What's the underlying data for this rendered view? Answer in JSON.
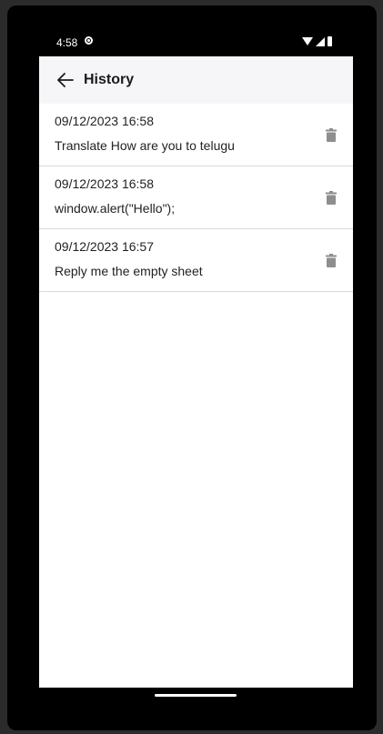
{
  "status_bar": {
    "time": "4:58"
  },
  "header": {
    "title": "History",
    "back_icon": "arrow-left-icon"
  },
  "history": [
    {
      "date": "09/12/2023 16:58",
      "text": "Translate How are you to telugu"
    },
    {
      "date": "09/12/2023 16:58",
      "text": "window.alert(\"Hello\");"
    },
    {
      "date": "09/12/2023 16:57",
      "text": "Reply me the empty sheet"
    }
  ],
  "icons": {
    "delete": "trash-icon"
  },
  "colors": {
    "appbar": "#f6f6f8",
    "icon_gray": "#8e8e8e",
    "divider": "#d9d9d9"
  }
}
